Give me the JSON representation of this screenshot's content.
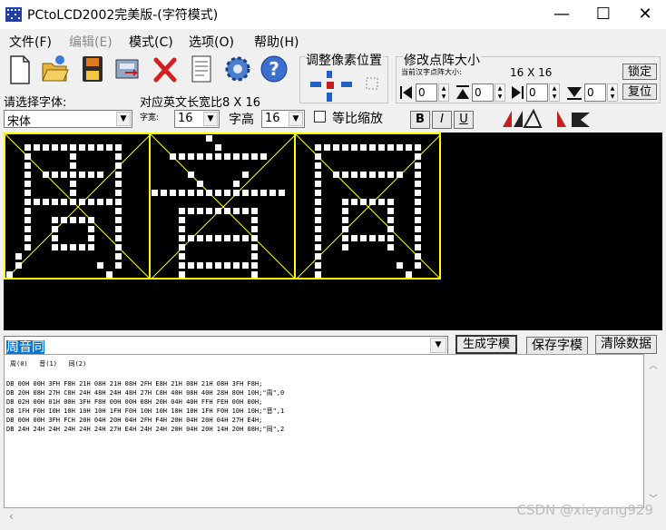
{
  "window": {
    "title": "PCtoLCD2002完美版-(字符模式)",
    "minimize": "—",
    "maximize": "☐",
    "close": "✕"
  },
  "menu": [
    "文件(F)",
    "编辑(E)",
    "模式(C)",
    "选项(O)",
    "帮助(H)"
  ],
  "toolbar_icons": [
    "new-file-icon",
    "open-folder-icon",
    "save-icon",
    "export-icon",
    "delete-icon",
    "document-icon",
    "settings-gear-icon",
    "help-icon"
  ],
  "font_panel": {
    "select_font_label": "请选择字体:",
    "font_value": "宋体",
    "wide_label": "字宽:",
    "wide_value": "16",
    "height_label": "字高",
    "height_value": "16",
    "proportional_label": "等比缩放",
    "bold": "B",
    "italic": "I",
    "underline": "U",
    "ratio_label": "对应英文长宽比8 X 16"
  },
  "adjust_panel": {
    "title": "调整像素位置"
  },
  "dot_panel": {
    "title": "修改点阵大小",
    "current_label": "当前汉字点阵大小:",
    "current_value": "16 X 16",
    "lock_button": "锁定",
    "reset_button": "复位",
    "spins": [
      "0",
      "0",
      "0",
      "0"
    ]
  },
  "input": {
    "text": "周音同",
    "generate_button": "生成字模",
    "save_button": "保存字模",
    "clear_button": "清除数据"
  },
  "output": {
    "header": "周(0)   音(1)   同(2)",
    "lines": [
      "DB 00H 00H 3FH F8H 21H 08H 21H 08H 2FH E8H 21H 08H 21H 08H 3FH F8H;",
      "DB 20H 08H 27H C8H 24H 48H 24H 48H 27H C8H 40H 08H 40H 28H 80H 10H;\"周\",0",
      "DB 02H 00H 01H 00H 3FH F8H 00H 00H 08H 20H 04H 40H FFH FEH 00H 00H;",
      "DB 1FH F0H 10H 10H 10H 10H 1FH F0H 10H 10H 10H 10H 1FH F0H 10H 10H;\"音\",1",
      "DB 00H 00H 3FH FCH 20H 04H 20H 04H 2FH F4H 20H 04H 20H 04H 27H E4H;",
      "DB 24H 24H 24H 24H 24H 24H 27H E4H 24H 24H 20H 04H 20H 14H 20H 08H;\"同\",2"
    ]
  },
  "watermark": "CSDN @xieyang929",
  "glyphs": {
    "zhou": [
      "0000000000000000",
      "0011111111111000",
      "0010000100001000",
      "0010000100001000",
      "0010111111101000",
      "0010000100001000",
      "0010000100001000",
      "0011111111111000",
      "0010000000001000",
      "0010011111001000",
      "0010010001001000",
      "0010010001001000",
      "0010011111001000",
      "0100000000001000",
      "0100000000101000",
      "1000000000010000"
    ],
    "yin": [
      "0000001000000000",
      "0000000100000000",
      "0011111111111000",
      "0000000000000000",
      "0000100000100000",
      "0000010001000000",
      "1111111111111110",
      "0000000000000000",
      "0001111111110000",
      "0001000000010000",
      "0001000000010000",
      "0001111111110000",
      "0001000000010000",
      "0001000000010000",
      "0001111111110000",
      "0001000000010000"
    ],
    "tong": [
      "0000000000000000",
      "0011111111111100",
      "0010000000000100",
      "0010000000000100",
      "0010111111110100",
      "0010000000000100",
      "0010000000000100",
      "0010011111100100",
      "0010010000100100",
      "0010010000100100",
      "0010010000100100",
      "0010011111100100",
      "0010010000100100",
      "0010000000000100",
      "0010000000010100",
      "0010000000001000"
    ]
  },
  "colors": {
    "grid_line": "#ffff00",
    "pixel": "#ffffff",
    "canvas_bg": "#000000",
    "selection": "#0078d7"
  }
}
